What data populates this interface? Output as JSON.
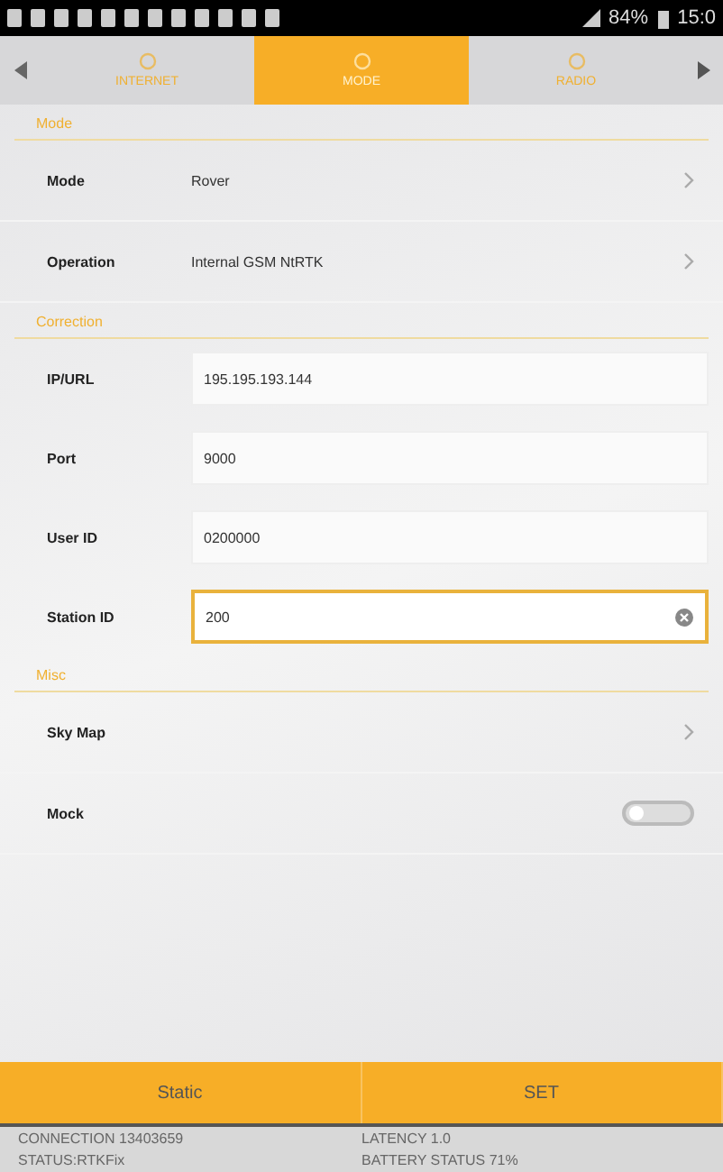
{
  "status_bar": {
    "battery": "84%",
    "time": "15:0"
  },
  "tabs": [
    {
      "label": "INTERNET",
      "selected": false
    },
    {
      "label": "MODE",
      "selected": true
    },
    {
      "label": "RADIO",
      "selected": false
    }
  ],
  "sections": [
    {
      "title": "Mode",
      "rows": [
        {
          "kind": "nav",
          "label": "Mode",
          "value": "Rover"
        },
        {
          "kind": "nav",
          "label": "Operation",
          "value": "Internal GSM NtRTK"
        }
      ]
    },
    {
      "title": "Correction",
      "rows": [
        {
          "kind": "field",
          "label": "IP/URL",
          "value": "195.195.193.144",
          "focused": false
        },
        {
          "kind": "field",
          "label": "Port",
          "value": "9000",
          "focused": false
        },
        {
          "kind": "field",
          "label": "User ID",
          "value": "0200000",
          "focused": false
        },
        {
          "kind": "field",
          "label": "Station ID",
          "value": "200",
          "focused": true
        }
      ]
    },
    {
      "title": "Misc",
      "rows": [
        {
          "kind": "nav",
          "label": "Sky Map"
        },
        {
          "kind": "toggle",
          "label": "Mock",
          "on": false
        }
      ]
    }
  ],
  "buttons": [
    "Static",
    "SET"
  ],
  "footer": [
    "CONNECTION 13403659",
    "LATENCY 1.0",
    "STATUS:RTKFix",
    "BATTERY STATUS 71%"
  ]
}
